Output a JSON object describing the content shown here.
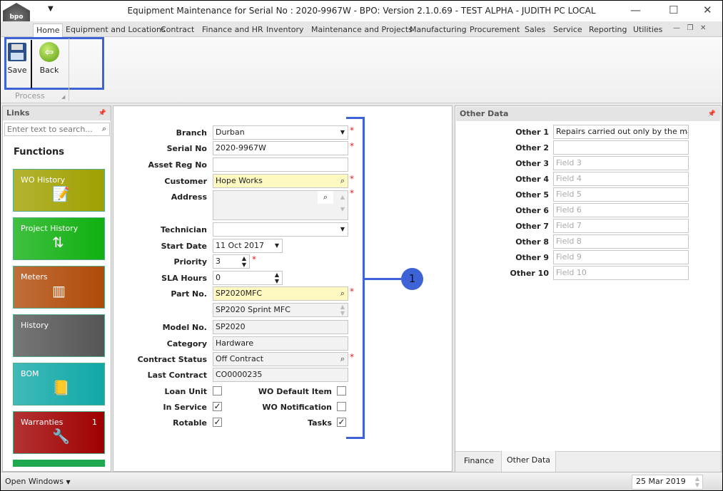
{
  "window": {
    "title": "Equipment Maintenance for Serial No : 2020-9967W - BPO: Version 2.1.0.69 - TEST ALPHA - JUDITH PC LOCAL",
    "logo": "bpo"
  },
  "menu_tabs": [
    "Home",
    "Equipment and Locations",
    "Contract",
    "Finance and HR",
    "Inventory",
    "Maintenance and Projects",
    "Manufacturing",
    "Procurement",
    "Sales",
    "Service",
    "Reporting",
    "Utilities"
  ],
  "ribbon": {
    "save": "Save",
    "back": "Back",
    "group": "Process"
  },
  "links": {
    "title": "Links",
    "search_placeholder": "Enter text to search...",
    "functions_title": "Functions",
    "tiles": [
      {
        "label": "WO History",
        "badge": "",
        "color": "#a0a000"
      },
      {
        "label": "Project History",
        "badge": "",
        "color": "#10b010"
      },
      {
        "label": "Meters",
        "badge": "",
        "color": "#b04a08"
      },
      {
        "label": "History",
        "badge": "",
        "color": "#555555"
      },
      {
        "label": "BOM",
        "badge": "",
        "color": "#10a8a8"
      },
      {
        "label": "Warranties",
        "badge": "1",
        "color": "#a00000"
      }
    ]
  },
  "form": {
    "branch": {
      "label": "Branch",
      "value": "Durban"
    },
    "serial_no": {
      "label": "Serial No",
      "value": "2020-9967W"
    },
    "asset_reg_no": {
      "label": "Asset Reg No",
      "value": ""
    },
    "customer": {
      "label": "Customer",
      "value": "Hope Works"
    },
    "address": {
      "label": "Address",
      "value": ""
    },
    "technician": {
      "label": "Technician",
      "value": ""
    },
    "start_date": {
      "label": "Start Date",
      "value": "11 Oct 2017"
    },
    "priority": {
      "label": "Priority",
      "value": "3"
    },
    "sla_hours": {
      "label": "SLA Hours",
      "value": "0"
    },
    "part_no": {
      "label": "Part No.",
      "value": "SP2020MFC",
      "description": "SP2020 Sprint MFC"
    },
    "model_no": {
      "label": "Model No.",
      "value": "SP2020"
    },
    "category": {
      "label": "Category",
      "value": "Hardware"
    },
    "contract_status": {
      "label": "Contract Status",
      "value": "Off Contract"
    },
    "last_contract": {
      "label": "Last Contract",
      "value": "CO0000235"
    },
    "loan_unit": {
      "label": "Loan Unit",
      "checked": false
    },
    "in_service": {
      "label": "In Service",
      "checked": true
    },
    "rotable": {
      "label": "Rotable",
      "checked": true
    },
    "wo_default_item": {
      "label": "WO Default Item",
      "checked": false
    },
    "wo_notification": {
      "label": "WO Notification",
      "checked": false
    },
    "tasks": {
      "label": "Tasks",
      "checked": true
    }
  },
  "annotation": {
    "number": "1",
    "color": "#3d63d6"
  },
  "other_data": {
    "title": "Other Data",
    "fields": [
      {
        "label": "Other 1",
        "value": "Repairs carried out only by the manufa",
        "placeholder": ""
      },
      {
        "label": "Other 2",
        "value": "",
        "placeholder": ""
      },
      {
        "label": "Other 3",
        "value": "",
        "placeholder": "Field 3"
      },
      {
        "label": "Other 4",
        "value": "",
        "placeholder": "Field 4"
      },
      {
        "label": "Other 5",
        "value": "",
        "placeholder": "Field 5"
      },
      {
        "label": "Other 6",
        "value": "",
        "placeholder": "Field 6"
      },
      {
        "label": "Other 7",
        "value": "",
        "placeholder": "Field 7"
      },
      {
        "label": "Other 8",
        "value": "",
        "placeholder": "Field 8"
      },
      {
        "label": "Other 9",
        "value": "",
        "placeholder": "Field 9"
      },
      {
        "label": "Other 10",
        "value": "",
        "placeholder": "Field 10"
      }
    ],
    "tabs": [
      "Finance",
      "Other Data"
    ],
    "active_tab": "Other Data"
  },
  "status": {
    "open_windows": "Open Windows",
    "date": "25 Mar 2019"
  }
}
